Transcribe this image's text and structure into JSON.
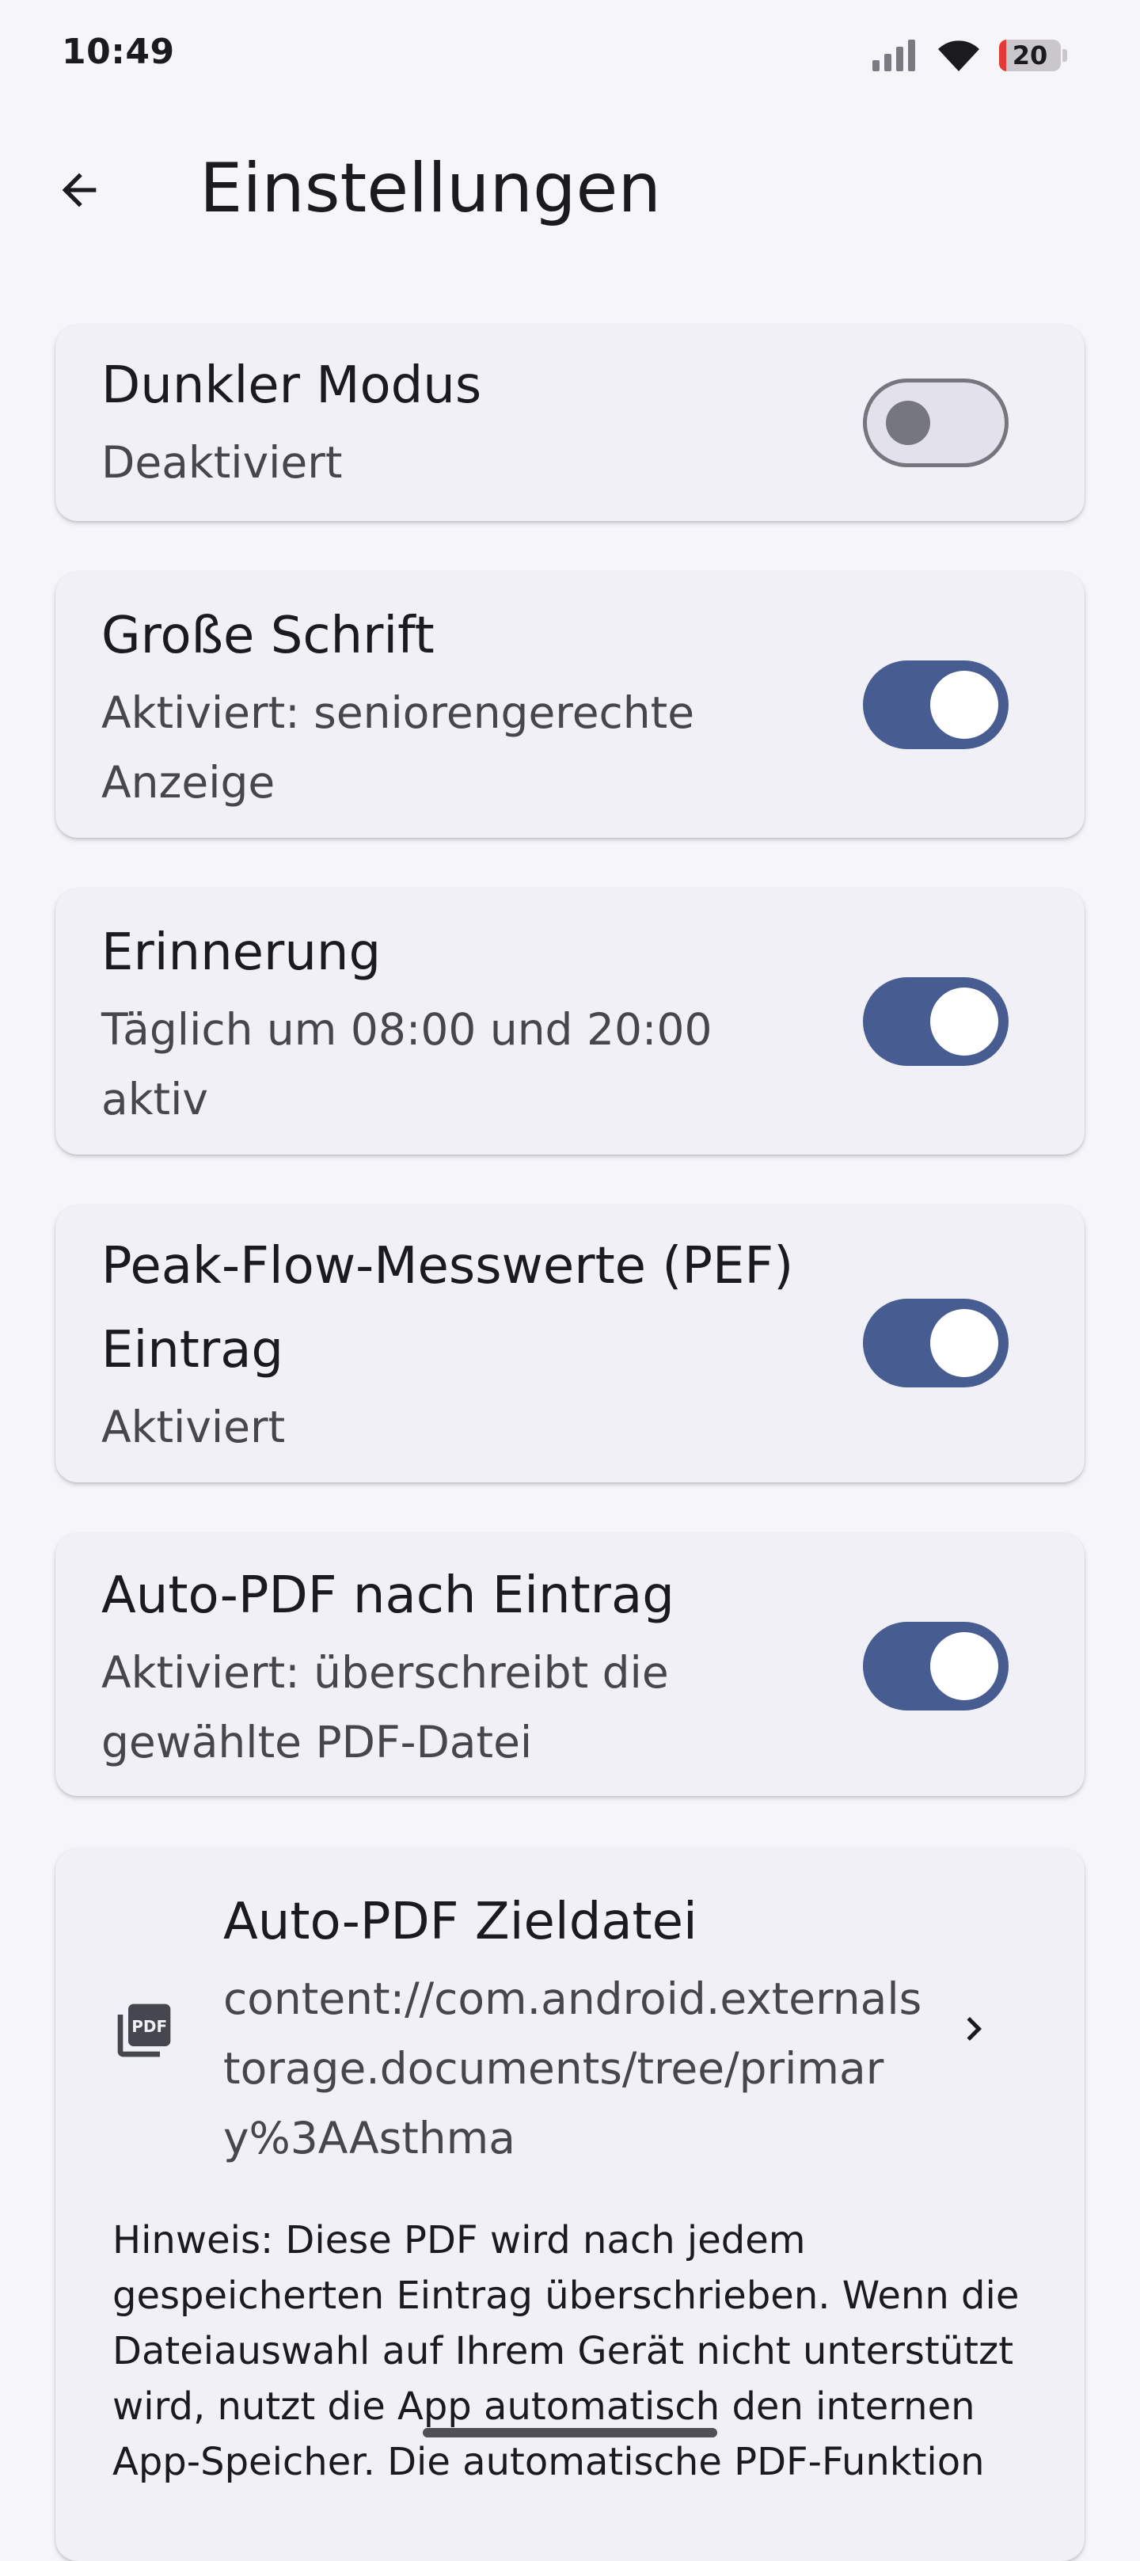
{
  "status_bar": {
    "time": "10:49",
    "battery": "20",
    "battery_level": 0.2,
    "icons": [
      "signal-icon",
      "wifi-icon",
      "battery-icon"
    ]
  },
  "app_bar": {
    "title": "Einstellungen",
    "back_icon": "arrow-back-icon"
  },
  "settings": {
    "dark_mode": {
      "title": "Dunkler Modus",
      "subtitle": "Deaktiviert",
      "enabled": false
    },
    "large_font": {
      "title": "Große Schrift",
      "subtitle": "Aktiviert: seniorengerechte Anzeige",
      "enabled": true
    },
    "reminder": {
      "title": "Erinnerung",
      "subtitle": "Täglich um 08:00 und 20:00 aktiv",
      "enabled": true
    },
    "pef": {
      "title": "Peak-Flow-Messwerte (PEF) Eintrag",
      "subtitle": "Aktiviert",
      "enabled": true
    },
    "auto_pdf": {
      "title": "Auto-PDF nach Eintrag",
      "subtitle": "Aktiviert: überschreibt die gewählte PDF-Datei",
      "enabled": true
    },
    "pdf_target": {
      "title": "Auto-PDF Zieldatei",
      "path": "content://com.android.externalstorage.documents/tree/primary%3AAsthma",
      "icon": "pdf-file-icon",
      "chevron": "chevron-right-icon",
      "hint": "Hinweis: Diese PDF wird nach jedem gespeicherten Eintrag überschrieben. Wenn die Dateiauswahl auf Ihrem Gerät nicht unterstützt wird, nutzt die App automatisch den internen App-Speicher. Die automatische PDF-Funktion"
    }
  },
  "colors": {
    "background": "#f6f5fa",
    "card": "#f1f0f6",
    "switch_on": "#475d92",
    "switch_off_track": "#e3e1ea",
    "switch_off_thumb": "#76767f",
    "text_primary": "#1b1b1f",
    "text_secondary": "#46464f",
    "battery_low": "#e53935"
  }
}
